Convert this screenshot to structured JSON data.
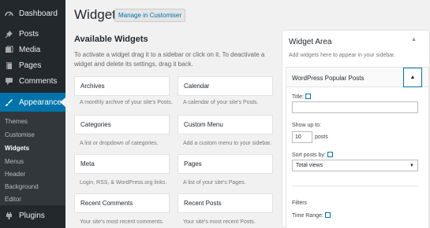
{
  "sidebar": {
    "items": [
      {
        "label": "Dashboard",
        "icon": "dashboard-icon"
      },
      {
        "label": "Posts",
        "icon": "pushpin-icon"
      },
      {
        "label": "Media",
        "icon": "media-icon"
      },
      {
        "label": "Pages",
        "icon": "pages-icon"
      },
      {
        "label": "Comments",
        "icon": "comments-icon"
      },
      {
        "label": "Appearance",
        "icon": "paintbrush-icon"
      },
      {
        "label": "Plugins",
        "icon": "plugin-icon"
      }
    ],
    "submenu": [
      "Themes",
      "Customise",
      "Widgets",
      "Menus",
      "Header",
      "Background",
      "Editor"
    ],
    "active_color": "#0073aa"
  },
  "header": {
    "title": "Widgets",
    "customiser_button": "Manage in Customiser"
  },
  "available": {
    "title": "Available Widgets",
    "description": "To activate a widget drag it to a sidebar or click on it. To deactivate a widget and delete its settings, drag it back.",
    "widgets": [
      {
        "name": "Archives",
        "desc": "A monthly archive of your site's Posts."
      },
      {
        "name": "Calendar",
        "desc": "A calendar of your site's Posts."
      },
      {
        "name": "Categories",
        "desc": "A list or dropdown of categories."
      },
      {
        "name": "Custom Menu",
        "desc": "Add a custom menu to your sidebar."
      },
      {
        "name": "Meta",
        "desc": "Login, RSS, & WordPress.org links."
      },
      {
        "name": "Pages",
        "desc": "A list of your site's Pages."
      },
      {
        "name": "Recent Comments",
        "desc": "Your site's most recent comments."
      },
      {
        "name": "Recent Posts",
        "desc": "Your site's most recent Posts."
      }
    ]
  },
  "area": {
    "title": "Widget Area",
    "subtitle": "Add widgets here to appear in your sidebar.",
    "widget": {
      "title": "WordPress Popular Posts",
      "title_label": "Title:",
      "title_value": "",
      "show_up_to_label": "Show up to:",
      "show_up_to_value": "10",
      "posts_suffix": "posts",
      "sort_label": "Sort posts by:",
      "sort_value": "Total views",
      "filters_label": "Filters",
      "time_range_label": "Time Range:"
    }
  }
}
